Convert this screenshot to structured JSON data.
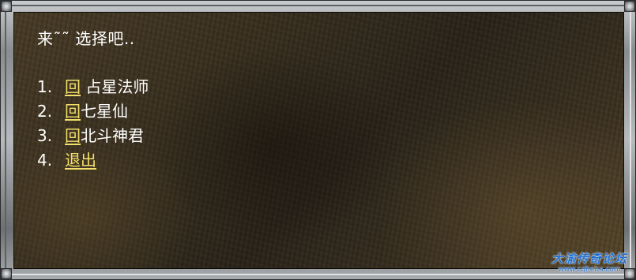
{
  "dialog": {
    "greeting": "来˜˜ 选择吧..",
    "options": [
      {
        "number": "1.",
        "link": "回",
        "text": " 占星法师"
      },
      {
        "number": "2.",
        "link": "回",
        "text": "七星仙"
      },
      {
        "number": "3.",
        "link": "回",
        "text": "北斗神君"
      },
      {
        "number": "4.",
        "link": "退出",
        "text": ""
      }
    ],
    "colors": {
      "link": "#f3e06a",
      "text": "#ffffff",
      "watermark": "#1f6fd0"
    }
  },
  "watermark": {
    "title": "大渝传奇论坛",
    "url": "www.cqheba.com"
  }
}
